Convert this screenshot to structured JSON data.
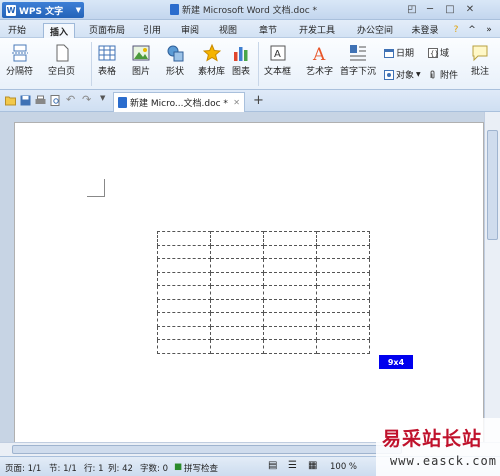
{
  "app": {
    "name": "WPS 文字",
    "title": "新建 Microsoft Word 文档.doc *"
  },
  "window_controls": {
    "user": "未登录"
  },
  "menu": {
    "tabs": [
      "开始",
      "插入",
      "页面布局",
      "引用",
      "审阅",
      "视图",
      "章节",
      "开发工具",
      "办公空间"
    ],
    "active": "插入"
  },
  "ribbon": {
    "page_break": "分隔符",
    "blank_page": "空白页",
    "table": "表格",
    "picture": "图片",
    "shape": "形状",
    "material": "素材库",
    "chart": "图表",
    "textbox": "文本框",
    "wordart": "艺术字",
    "dropcap": "首字下沉",
    "date": "日期",
    "field": "域",
    "object": "对象",
    "attachment": "附件",
    "comment": "批注"
  },
  "doctab": {
    "label": "新建 Micro...文档.doc *"
  },
  "table_insert": {
    "size_label": "9x4",
    "rows": 9,
    "cols": 4
  },
  "status": {
    "page": "页面: 1/1",
    "section": "节: 1/1",
    "row": "行: 1",
    "col": "列: 42",
    "wordcount": "字数: 0",
    "spellcheck": "拼写检查",
    "zoom": "100 %"
  },
  "watermark": {
    "line1": "易采站长站",
    "line2": "www.easck.com"
  },
  "colors": {
    "accent": "#2463b8",
    "badge": "#0000ee",
    "ribbon_bg": "#e9f1fa"
  }
}
